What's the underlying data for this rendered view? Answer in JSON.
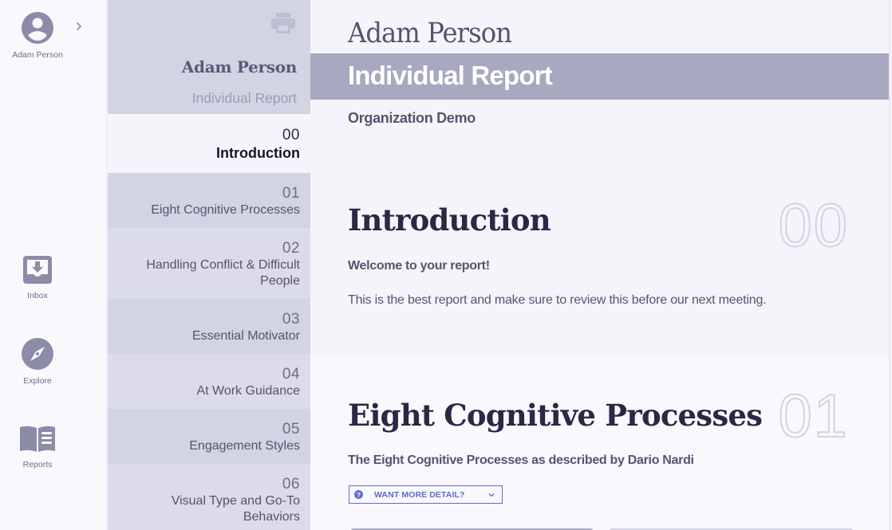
{
  "rail": {
    "user_name": "Adam Person",
    "expand_icon": "chevron-right-icon",
    "items": [
      {
        "label": "Inbox",
        "icon": "inbox-download-icon"
      },
      {
        "label": "Explore",
        "icon": "compass-icon"
      },
      {
        "label": "Reports",
        "icon": "book-open-icon"
      }
    ]
  },
  "section_nav": {
    "print_icon": "printer-icon",
    "person_name": "Adam Person",
    "report_type": "Individual Report",
    "items": [
      {
        "num": "00",
        "title": "Introduction",
        "active": true
      },
      {
        "num": "01",
        "title": "Eight Cognitive Processes"
      },
      {
        "num": "02",
        "title": "Handling Conflict & Difficult People"
      },
      {
        "num": "03",
        "title": "Essential Motivator"
      },
      {
        "num": "04",
        "title": "At Work Guidance"
      },
      {
        "num": "05",
        "title": "Engagement Styles"
      },
      {
        "num": "06",
        "title": "Visual Type and Go-To Behaviors"
      }
    ]
  },
  "header": {
    "person_name": "Adam Person",
    "report_title": "Individual Report",
    "organization": "Organization Demo"
  },
  "sections": {
    "intro": {
      "title": "Introduction",
      "number": "00",
      "subtitle": "Welcome to your report!",
      "body": "This is the best report and make sure to review this before our next meeting."
    },
    "s01": {
      "title": "Eight Cognitive Processes",
      "number": "01",
      "subtitle": "The Eight Cognitive Processes as described by Dario Nardi",
      "detail_button": "WANT MORE DETAIL?"
    }
  },
  "colors": {
    "accent": "#5e6ccd",
    "band": "#a8a8c0",
    "nav_bg": "#d2d3e3",
    "text": "#55546f",
    "heading": "#2a2845"
  }
}
